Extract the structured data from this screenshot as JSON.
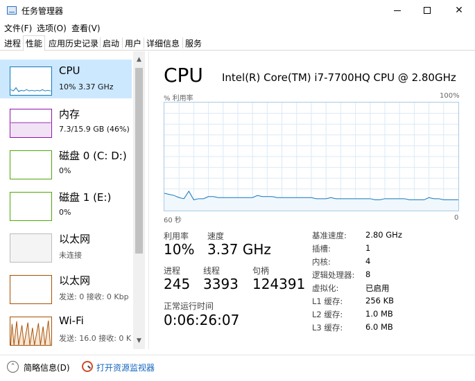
{
  "window": {
    "title": "任务管理器",
    "min_glyph": "—",
    "close_glyph": "✕"
  },
  "menu": [
    "文件(F)",
    "选项(O)",
    "查看(V)"
  ],
  "tabs": [
    "进程",
    "性能",
    "应用历史记录",
    "启动",
    "用户",
    "详细信息",
    "服务"
  ],
  "active_tab": "性能",
  "sidebar": {
    "items": [
      {
        "name": "CPU",
        "sub": "10%  3.37 GHz",
        "color": "#1177bb",
        "icon": "cpu-graph-icon"
      },
      {
        "name": "内存",
        "sub": "7.3/15.9 GB (46%)",
        "color": "#8b12ae",
        "icon": "memory-graph-icon"
      },
      {
        "name": "磁盘 0 (C: D:)",
        "sub": "0%",
        "color": "#4da60c",
        "icon": "disk-graph-icon"
      },
      {
        "name": "磁盘 1 (E:)",
        "sub": "0%",
        "color": "#4da60c",
        "icon": "disk-graph-icon"
      },
      {
        "name": "以太网",
        "sub": "未连接",
        "color": "#bbbbbb",
        "icon": "ethernet-graph-icon"
      },
      {
        "name": "以太网",
        "sub": "发送: 0  接收: 0 Kbp",
        "color": "#a74f01",
        "icon": "ethernet-graph-icon"
      },
      {
        "name": "Wi-Fi",
        "sub": "发送: 16.0  接收: 0 K",
        "color": "#a74f01",
        "icon": "wifi-graph-icon"
      }
    ]
  },
  "main": {
    "title": "CPU",
    "model": "Intel(R) Core(TM) i7-7700HQ CPU @ 2.80GHz",
    "graph": {
      "y_label": "% 利用率",
      "y_max": "100%",
      "x_left": "60 秒",
      "x_right": "0",
      "color": "#1177bb",
      "utilization_pct": [
        16,
        15,
        14,
        12,
        11,
        18,
        10,
        11,
        11,
        13,
        13,
        12,
        12,
        12,
        12,
        12,
        12,
        12,
        12,
        14,
        13,
        13,
        13,
        12,
        12,
        12,
        12,
        12,
        12,
        12,
        12,
        11,
        11,
        11,
        12,
        11,
        11,
        11,
        11,
        11,
        11,
        11,
        11,
        10,
        10,
        11,
        11,
        11,
        11,
        11,
        10,
        10,
        10,
        10,
        12,
        11,
        11,
        10,
        10,
        10,
        10
      ]
    },
    "stats": {
      "util_label": "利用率",
      "util_value": "10%",
      "speed_label": "速度",
      "speed_value": "3.37 GHz",
      "proc_label": "进程",
      "proc_value": "245",
      "thread_label": "线程",
      "thread_value": "3393",
      "handle_label": "句柄",
      "handle_value": "124391",
      "uptime_label": "正常运行时间",
      "uptime_value": "0:06:26:07"
    },
    "specs": [
      {
        "k": "基准速度:",
        "v": "2.80 GHz"
      },
      {
        "k": "插槽:",
        "v": "1"
      },
      {
        "k": "内核:",
        "v": "4"
      },
      {
        "k": "逻辑处理器:",
        "v": "8"
      },
      {
        "k": "虚拟化:",
        "v": "已启用"
      },
      {
        "k": "L1 缓存:",
        "v": "256 KB"
      },
      {
        "k": "L2 缓存:",
        "v": "1.0 MB"
      },
      {
        "k": "L3 缓存:",
        "v": "6.0 MB"
      }
    ]
  },
  "footer": {
    "fewer_details": "简略信息(D)",
    "resource_monitor": "打开资源监视器",
    "chevron_glyph": "⌃",
    "up_glyph": "▲",
    "down_glyph": "▼"
  }
}
